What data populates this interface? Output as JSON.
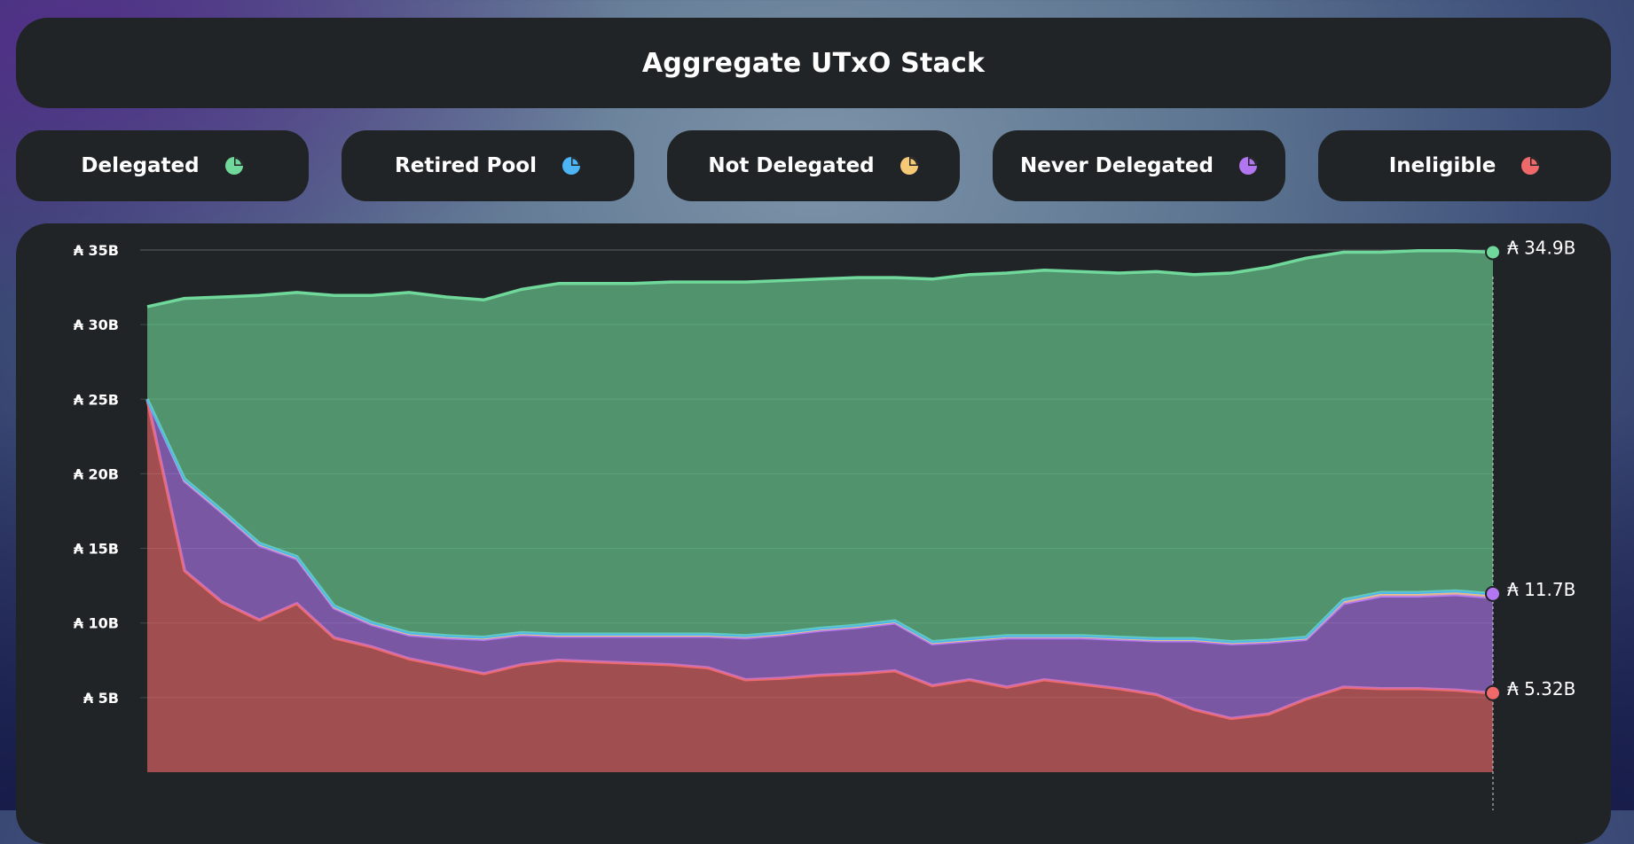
{
  "title": "Aggregate UTxO Stack",
  "legend": [
    {
      "label": "Delegated",
      "icon": "pie-chart-icon",
      "color": "#6fd89a"
    },
    {
      "label": "Retired Pool",
      "icon": "pie-chart-icon",
      "color": "#4db4f5"
    },
    {
      "label": "Not Delegated",
      "icon": "pie-chart-icon",
      "color": "#f6c977"
    },
    {
      "label": "Never Delegated",
      "icon": "pie-chart-icon",
      "color": "#b277f0"
    },
    {
      "label": "Ineligible",
      "icon": "pie-chart-icon",
      "color": "#f0696a"
    }
  ],
  "chart_data": {
    "type": "area",
    "stacked": true,
    "y_tick_labels": [
      "₳ 5B",
      "₳ 10B",
      "₳ 15B",
      "₳ 20B",
      "₳ 25B",
      "₳ 30B",
      "₳ 35B"
    ],
    "ylim": [
      0,
      37.5
    ],
    "y_unit": "B",
    "grid": true,
    "hover_values": [
      "₳ 34.9B",
      "₳ 11.7B",
      "₳ 5.32B"
    ],
    "series": [
      {
        "name": "Ineligible",
        "color": "#f0696a",
        "values": [
          25.0,
          13.5,
          11.4,
          10.2,
          11.3,
          9.0,
          8.4,
          7.6,
          7.1,
          6.6,
          7.2,
          7.5,
          7.4,
          7.3,
          7.2,
          7.0,
          6.2,
          6.3,
          6.5,
          6.6,
          6.8,
          5.8,
          6.2,
          5.7,
          6.2,
          5.9,
          5.6,
          5.2,
          4.2,
          3.6,
          3.9,
          4.9,
          5.7,
          5.6,
          5.6,
          5.5,
          5.3
        ]
      },
      {
        "name": "Never Delegated",
        "color": "#b277f0",
        "values": [
          0.0,
          6.0,
          6.0,
          5.0,
          3.0,
          2.0,
          1.5,
          1.6,
          1.9,
          2.3,
          2.0,
          1.6,
          1.7,
          1.8,
          1.9,
          2.1,
          2.8,
          2.9,
          3.0,
          3.1,
          3.2,
          2.8,
          2.6,
          3.3,
          2.8,
          3.1,
          3.3,
          3.6,
          4.6,
          5.0,
          4.8,
          4.0,
          5.6,
          6.2,
          6.2,
          6.4,
          6.4
        ]
      },
      {
        "name": "Not Delegated",
        "color": "#f6c977",
        "values": [
          0,
          0.1,
          0.1,
          0.1,
          0.1,
          0.1,
          0.1,
          0.1,
          0.1,
          0.1,
          0.1,
          0.1,
          0.1,
          0.1,
          0.1,
          0.1,
          0.1,
          0.1,
          0.1,
          0.1,
          0.1,
          0.1,
          0.1,
          0.1,
          0.1,
          0.1,
          0.1,
          0.1,
          0.1,
          0.1,
          0.1,
          0.1,
          0.2,
          0.2,
          0.2,
          0.2,
          0.2
        ]
      },
      {
        "name": "Retired Pool",
        "color": "#4db4f5",
        "values": [
          0,
          0.05,
          0.05,
          0.05,
          0.05,
          0.05,
          0.05,
          0.05,
          0.05,
          0.05,
          0.05,
          0.05,
          0.05,
          0.05,
          0.05,
          0.05,
          0.05,
          0.05,
          0.05,
          0.05,
          0.05,
          0.05,
          0.05,
          0.05,
          0.05,
          0.05,
          0.05,
          0.05,
          0.05,
          0.05,
          0.05,
          0.05,
          0.05,
          0.05,
          0.05,
          0.05,
          0.05
        ]
      },
      {
        "name": "Delegated",
        "color": "#6fd89a",
        "values": [
          6.2,
          12.1,
          14.3,
          16.6,
          17.7,
          20.8,
          21.9,
          22.8,
          22.7,
          22.6,
          23.0,
          23.5,
          23.5,
          23.5,
          23.6,
          23.6,
          23.7,
          23.6,
          23.4,
          23.3,
          23.0,
          24.3,
          24.4,
          24.3,
          24.5,
          24.4,
          24.4,
          24.6,
          24.4,
          24.7,
          25.0,
          25.4,
          23.3,
          22.8,
          22.9,
          22.8,
          22.9
        ]
      }
    ]
  }
}
